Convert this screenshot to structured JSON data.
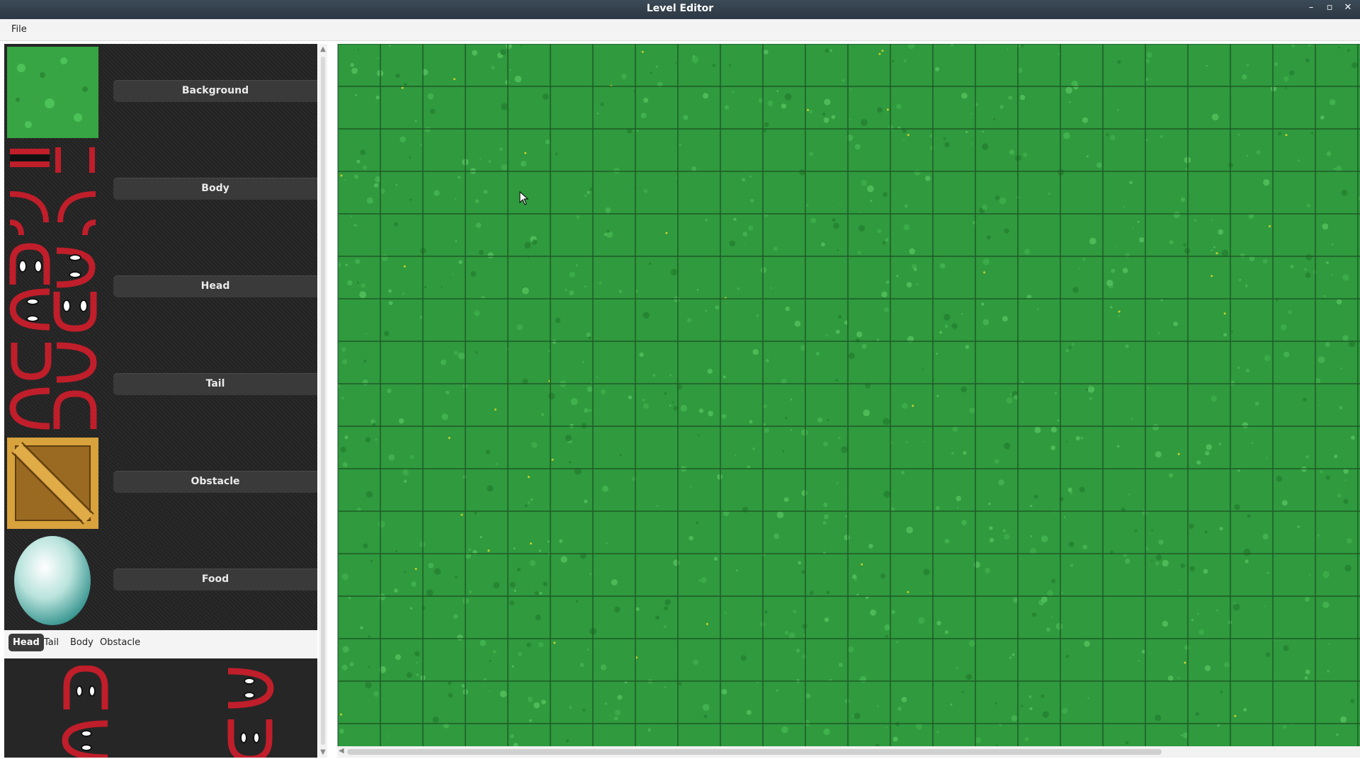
{
  "window": {
    "title": "Level Editor",
    "minimize": "–",
    "maximize": "▫",
    "close": "✕"
  },
  "menu": {
    "file": "File"
  },
  "palette": [
    {
      "label": "Background",
      "icon": "grass-tile-icon"
    },
    {
      "label": "Body",
      "icon": "snake-body-tiles-icon"
    },
    {
      "label": "Head",
      "icon": "snake-head-tiles-icon"
    },
    {
      "label": "Tail",
      "icon": "snake-tail-tiles-icon"
    },
    {
      "label": "Obstacle",
      "icon": "wooden-crate-icon"
    },
    {
      "label": "Food",
      "icon": "egg-icon"
    }
  ],
  "tabs": [
    {
      "label": "Head",
      "active": true
    },
    {
      "label": "Tail",
      "active": false
    },
    {
      "label": "Body",
      "active": false
    },
    {
      "label": "Obstacle",
      "active": false
    }
  ],
  "colors": {
    "grass": "#2f9a3e",
    "grid": "#1f5a26",
    "snake_red": "#c01e2a",
    "panel": "#262626"
  }
}
